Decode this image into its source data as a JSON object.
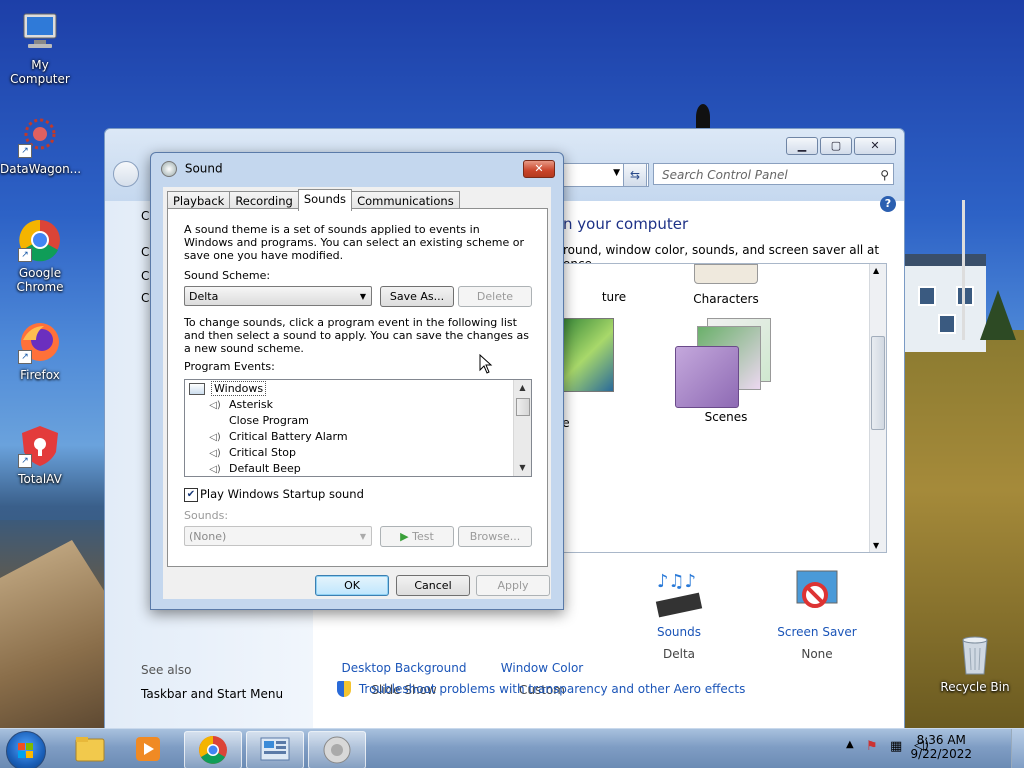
{
  "desktop": {
    "icons": [
      {
        "name": "my-computer",
        "label": "My Computer"
      },
      {
        "name": "datawagon",
        "label": "DataWagon..."
      },
      {
        "name": "google-chrome",
        "label": "Google Chrome"
      },
      {
        "name": "firefox",
        "label": "Firefox"
      },
      {
        "name": "totalav",
        "label": "TotalAV"
      },
      {
        "name": "recycle-bin",
        "label": "Recycle Bin"
      }
    ]
  },
  "control_panel": {
    "search_placeholder": "Search Control Panel",
    "heading": "n your computer",
    "subheading": "round, window color, sounds, and screen saver all at once.",
    "left_partial": [
      "C",
      "C",
      "C",
      "C"
    ],
    "themes": [
      {
        "label": "ture"
      },
      {
        "label": "Characters"
      },
      {
        "label": "e"
      },
      {
        "label": "Scenes"
      }
    ],
    "see_also_label": "See also",
    "see_also_link": "Taskbar and Start Menu",
    "bottom_items": [
      {
        "label": "Desktop Background",
        "value": "Slide Show"
      },
      {
        "label": "Window Color",
        "value": "Custom"
      },
      {
        "label": "Sounds",
        "value": "Delta"
      },
      {
        "label": "Screen Saver",
        "value": "None"
      }
    ],
    "troubleshoot_link": "Troubleshoot problems with transparency and other Aero effects"
  },
  "sound_dialog": {
    "title": "Sound",
    "tabs": [
      "Playback",
      "Recording",
      "Sounds",
      "Communications"
    ],
    "active_tab": "Sounds",
    "intro_text": "A sound theme is a set of sounds applied to events in Windows and programs.  You can select an existing scheme or save one you have modified.",
    "scheme_label": "Sound Scheme:",
    "scheme_value": "Delta",
    "save_as_label": "Save As...",
    "delete_label": "Delete",
    "change_text": "To change sounds, click a program event in the following list and then select a sound to apply.  You can save the changes as a new sound scheme.",
    "events_label": "Program Events:",
    "events": [
      {
        "label": "Windows",
        "has_sound": false,
        "is_group": true
      },
      {
        "label": "Asterisk",
        "has_sound": true,
        "is_group": false
      },
      {
        "label": "Close Program",
        "has_sound": false,
        "is_group": false
      },
      {
        "label": "Critical Battery Alarm",
        "has_sound": true,
        "is_group": false
      },
      {
        "label": "Critical Stop",
        "has_sound": true,
        "is_group": false
      },
      {
        "label": "Default Beep",
        "has_sound": true,
        "is_group": false
      }
    ],
    "startup_sound_label": "Play Windows Startup sound",
    "startup_sound_checked": true,
    "sounds_label": "Sounds:",
    "sounds_value": "(None)",
    "test_label": "Test",
    "browse_label": "Browse...",
    "ok_label": "OK",
    "cancel_label": "Cancel",
    "apply_label": "Apply"
  },
  "taskbar": {
    "time": "8:36 AM",
    "date": "9/22/2022"
  }
}
